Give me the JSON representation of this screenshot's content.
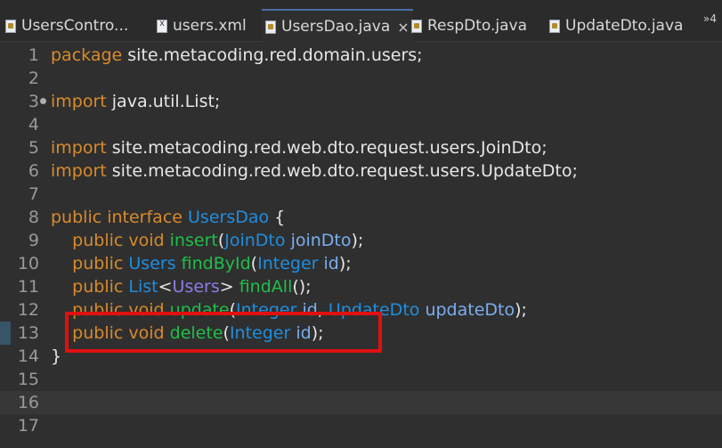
{
  "tabs": [
    {
      "label": "UsersContro...",
      "icon": "java-file-icon",
      "active": false
    },
    {
      "label": "users.xml",
      "icon": "xml-file-icon",
      "active": false
    },
    {
      "label": "UsersDao.java",
      "icon": "java-file-icon",
      "active": true,
      "close": "×"
    },
    {
      "label": "RespDto.java",
      "icon": "java-file-icon",
      "active": false
    },
    {
      "label": "UpdateDto.java",
      "icon": "java-file-icon",
      "active": false
    }
  ],
  "overflow": "»4",
  "lines": [
    {
      "n": "1"
    },
    {
      "n": "2"
    },
    {
      "n": "3"
    },
    {
      "n": "4"
    },
    {
      "n": "5"
    },
    {
      "n": "6"
    },
    {
      "n": "7"
    },
    {
      "n": "8"
    },
    {
      "n": "9"
    },
    {
      "n": "10"
    },
    {
      "n": "11"
    },
    {
      "n": "12"
    },
    {
      "n": "13"
    },
    {
      "n": "14"
    },
    {
      "n": "15"
    },
    {
      "n": "16"
    },
    {
      "n": "17"
    }
  ],
  "code": {
    "l1": {
      "kw": "package",
      "rest": " site.metacoding.red.domain.users;"
    },
    "l3": {
      "kw": "import",
      "rest": " java.util.List;"
    },
    "l5": {
      "kw": "import",
      "rest": " site.metacoding.red.web.dto.request.users.JoinDto;"
    },
    "l6": {
      "kw": "import",
      "rest": " site.metacoding.red.web.dto.request.users.UpdateDto;"
    },
    "l8": {
      "kw1": "public",
      "kw2": "interface",
      "name": "UsersDao",
      "brace": " {"
    },
    "l9": {
      "kw1": "public",
      "kw2": "void",
      "fn": "insert",
      "p1t": "JoinDto",
      "p1n": "joinDto",
      "end": ");"
    },
    "l10": {
      "kw1": "public",
      "ret": "Users",
      "fn": "findById",
      "p1t": "Integer",
      "p1n": "id",
      "end": ");"
    },
    "l11": {
      "kw1": "public",
      "ret": "List",
      "gen": "Users",
      "fn": "findAll",
      "end": "();"
    },
    "l12": {
      "kw1": "public",
      "kw2": "void",
      "fn": "update",
      "p1t": "Integer",
      "p1n": "id",
      "p2t": "UpdateDto",
      "p2n": "updateDto",
      "end": ");"
    },
    "l13": {
      "kw1": "public",
      "kw2": "void",
      "fn": "delete",
      "p1t": "Integer",
      "p1n": "id",
      "end": ");"
    },
    "l14": {
      "brace": "}"
    }
  },
  "colors": {
    "keyword": "#d98b2b",
    "type": "#1f8ee0",
    "method": "#1fbf4a",
    "variable": "#79aef0",
    "highlight": "#e01010"
  }
}
